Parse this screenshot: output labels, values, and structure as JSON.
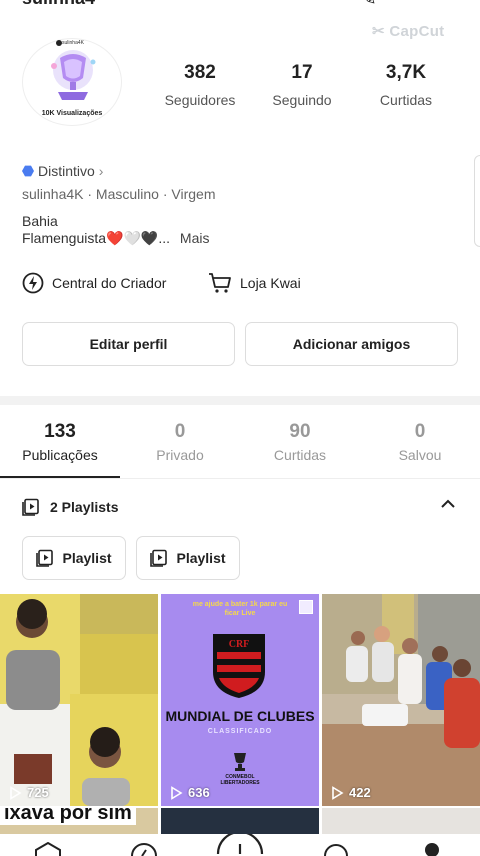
{
  "header": {
    "username_partial": "sulinha4",
    "watermark": "CapCut"
  },
  "avatar": {
    "small_label": "sulinha4K",
    "caption": "10K Visualizações"
  },
  "stats": [
    {
      "value": "382",
      "label": "Seguidores"
    },
    {
      "value": "17",
      "label": "Seguindo"
    },
    {
      "value": "3,7K",
      "label": "Curtidas"
    }
  ],
  "profile": {
    "badge": "Distintivo",
    "meta": "sulinha4K · Masculino · Virgem",
    "bio_line1": "Bahia",
    "bio_line2": "Flamenguista❤️🤍🖤...",
    "more": "Mais"
  },
  "links": {
    "creator_center": "Central do Criador",
    "shop": "Loja Kwai"
  },
  "buttons": {
    "edit_profile": "Editar perfil",
    "add_friends": "Adicionar amigos"
  },
  "tabs": [
    {
      "count": "133",
      "label": "Publicações",
      "active": true
    },
    {
      "count": "0",
      "label": "Privado",
      "active": false
    },
    {
      "count": "90",
      "label": "Curtidas",
      "active": false
    },
    {
      "count": "0",
      "label": "Salvou",
      "active": false
    }
  ],
  "playlists": {
    "header": "2 Playlists",
    "items": [
      "Playlist",
      "Playlist"
    ]
  },
  "grid": [
    {
      "views": "725"
    },
    {
      "views": "636",
      "overlay_top": "me ajude a bater 1k parar eu ficar Live",
      "overlay_main": "MUNDIAL DE CLUBES",
      "overlay_sub": "CLASSIFICADO",
      "overlay_logo": "CONMEBOL LIBERTADORES"
    },
    {
      "views": "422"
    }
  ],
  "row2": {
    "caption": "ixava por sim"
  },
  "colors": {
    "accent_badge": "#4a7cf0",
    "tile2_bg": "#a78bef",
    "flamengo_red": "#d01c1f"
  }
}
